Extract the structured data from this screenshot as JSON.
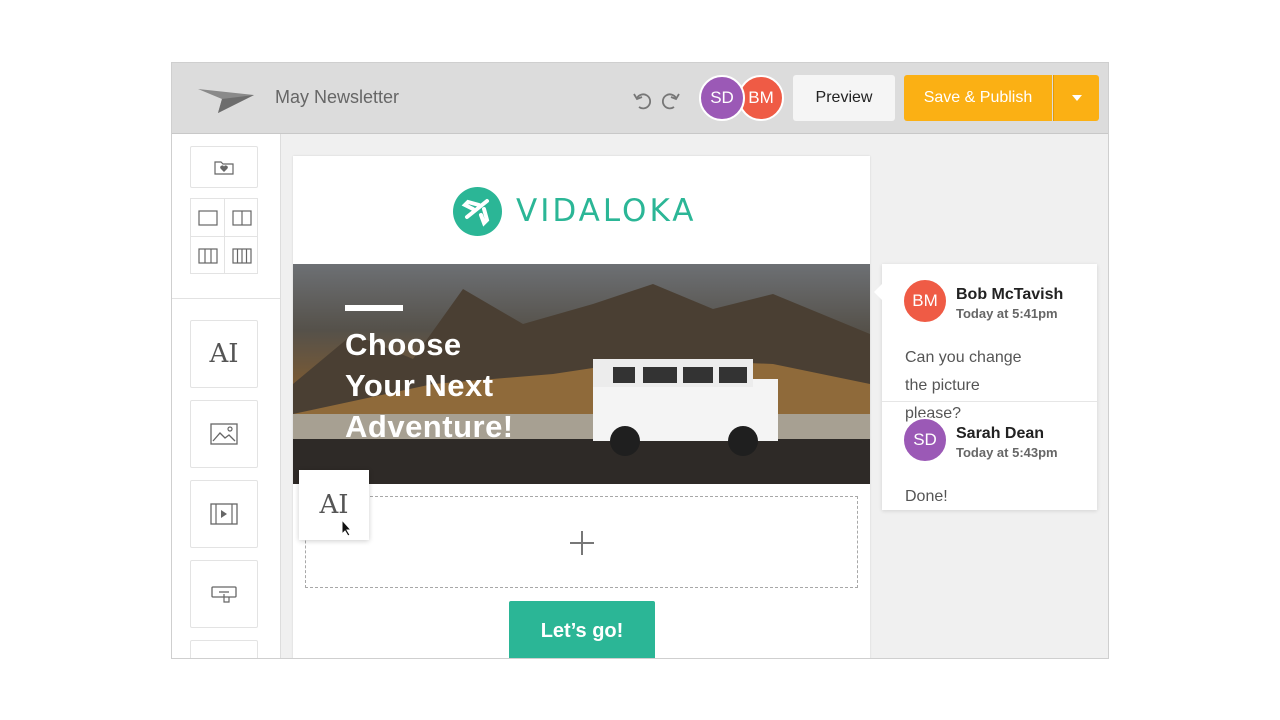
{
  "app": {
    "document_title": "May Newsletter"
  },
  "toolbar": {
    "collaborators": [
      {
        "initials": "SD",
        "color": "#9b59b6"
      },
      {
        "initials": "BM",
        "color": "#ef5b45"
      }
    ],
    "preview_label": "Preview",
    "publish_label": "Save & Publish",
    "accent_color": "#fbb014"
  },
  "sidebar": {
    "tools": [
      {
        "icon": "folder-heart-icon"
      },
      {
        "icon": "one-column-layout-icon"
      },
      {
        "icon": "two-column-layout-icon"
      },
      {
        "icon": "three-column-layout-icon"
      },
      {
        "icon": "four-column-layout-icon"
      },
      {
        "icon": "text-block-icon",
        "glyph": "AI"
      },
      {
        "icon": "image-block-icon"
      },
      {
        "icon": "video-block-icon"
      },
      {
        "icon": "button-block-icon"
      }
    ]
  },
  "email": {
    "brand_name": "VIDALOKA",
    "brand_color": "#2bb696",
    "hero_lines": [
      "Choose",
      "Your Next",
      "Adventure!"
    ],
    "floating_tool_glyph": "AI",
    "cta_label": "Let’s go!"
  },
  "comments": [
    {
      "initials": "BM",
      "author": "Bob McTavish",
      "time": "Today at 5:41pm",
      "lines": [
        "Can you change",
        "the picture please?"
      ],
      "color": "#ef5b45"
    },
    {
      "initials": "SD",
      "author": "Sarah Dean",
      "time": "Today at 5:43pm",
      "lines": [
        "Done!"
      ],
      "color": "#9b59b6"
    }
  ]
}
